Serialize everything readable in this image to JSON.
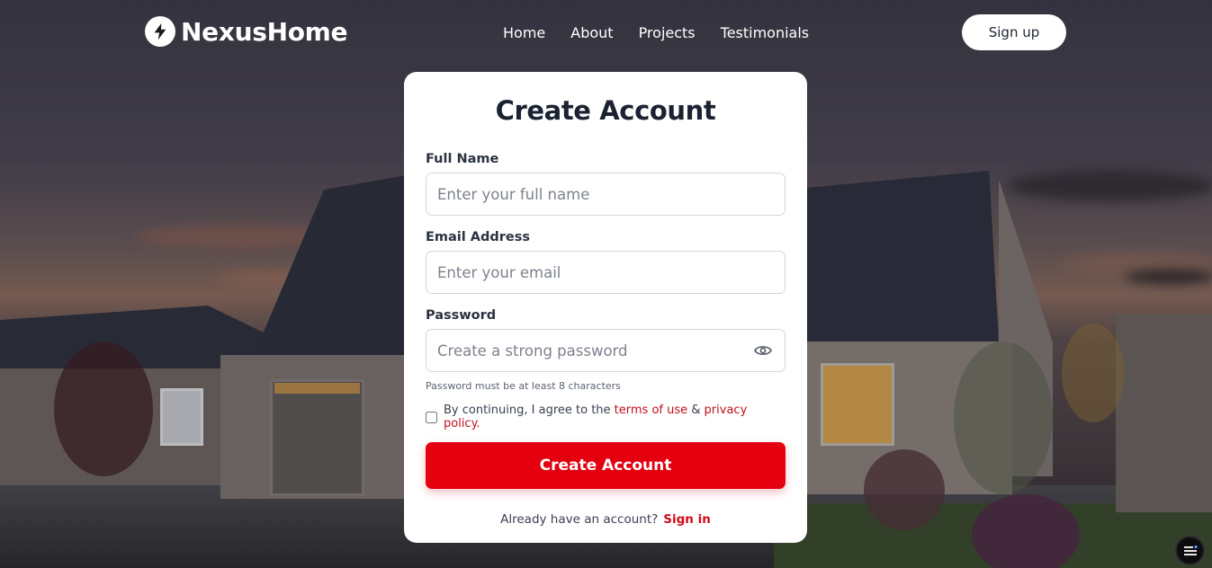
{
  "brand": {
    "name": "NexusHome",
    "icon": "bolt-icon"
  },
  "nav": {
    "items": [
      "Home",
      "About",
      "Projects",
      "Testimonials"
    ]
  },
  "header": {
    "signup_label": "Sign up"
  },
  "form": {
    "title": "Create Account",
    "full_name": {
      "label": "Full Name",
      "placeholder": "Enter your full name",
      "value": ""
    },
    "email": {
      "label": "Email Address",
      "placeholder": "Enter your email",
      "value": ""
    },
    "password": {
      "label": "Password",
      "placeholder": "Create a strong password",
      "value": "",
      "hint": "Password must be at least 8 characters",
      "toggle_icon": "eye-icon"
    },
    "agree": {
      "prefix": "By continuing, I agree to the",
      "terms": "terms of use",
      "amp": "&",
      "privacy": "privacy policy.",
      "checked": false
    },
    "submit_label": "Create Account",
    "signin_prompt": "Already have an account?",
    "signin_link": "Sign in"
  },
  "colors": {
    "accent": "#e4000f",
    "link": "#c10f1c",
    "title": "#1b2333"
  },
  "fab": {
    "icon": "menu-icon"
  }
}
